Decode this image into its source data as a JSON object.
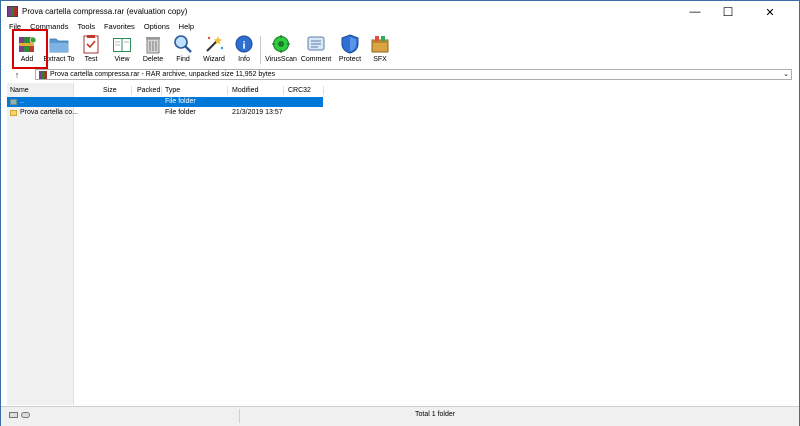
{
  "window": {
    "title": "Prova cartella compressa.rar (evaluation copy)",
    "controls": {
      "minimize": "—",
      "maximize": "☐",
      "close": "✕"
    }
  },
  "menu": [
    "File",
    "Commands",
    "Tools",
    "Favorites",
    "Options",
    "Help"
  ],
  "toolbar": {
    "add": "Add",
    "extract_to": "Extract To",
    "test": "Test",
    "view": "View",
    "delete": "Delete",
    "find": "Find",
    "wizard": "Wizard",
    "info": "Info",
    "virusscan": "VirusScan",
    "comment": "Comment",
    "protect": "Protect",
    "sfx": "SFX"
  },
  "address": {
    "up_glyph": "↑",
    "text": "Prova cartella compressa.rar - RAR archive, unpacked size 11,952 bytes",
    "caret": "⌄"
  },
  "columns": [
    "Name",
    "Size",
    "Packed",
    "Type",
    "Modified",
    "CRC32"
  ],
  "files": [
    {
      "name": "..",
      "size": "",
      "packed": "",
      "type": "File folder",
      "modified": "",
      "crc": "",
      "selected": true
    },
    {
      "name": "Prova cartella co...",
      "size": "",
      "packed": "",
      "type": "File folder",
      "modified": "21/3/2019 13:57",
      "crc": "",
      "selected": false
    }
  ],
  "status": {
    "summary": "Total 1 folder"
  },
  "colors": {
    "selection": "#0078d7",
    "highlight_box": "#d50000"
  }
}
